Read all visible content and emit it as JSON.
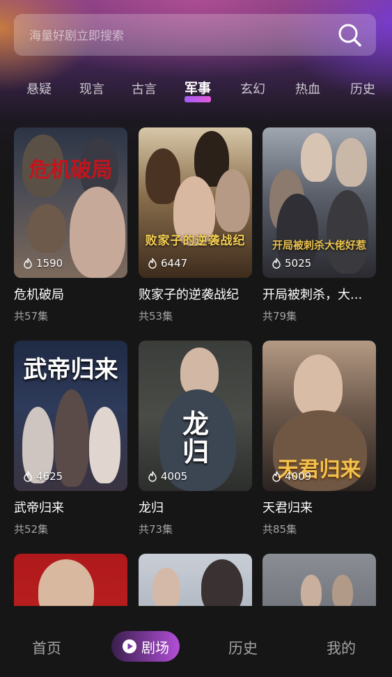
{
  "search": {
    "placeholder": "海量好剧立即搜索"
  },
  "tabs": [
    "悬疑",
    "现言",
    "古言",
    "军事",
    "玄幻",
    "热血",
    "历史"
  ],
  "active_tab": "军事",
  "cards": [
    {
      "title": "危机破局",
      "episodes": "共57集",
      "views": "1590",
      "poster_text": "危机破局"
    },
    {
      "title": "败家子的逆袭战纪",
      "episodes": "共53集",
      "views": "6447",
      "poster_text": "败家子的逆袭战纪"
    },
    {
      "title": "开局被刺杀，大...",
      "episodes": "共79集",
      "views": "5025",
      "poster_text": "开局被刺杀大佬好惹"
    },
    {
      "title": "武帝归来",
      "episodes": "共52集",
      "views": "4625",
      "poster_text": "武帝归来"
    },
    {
      "title": "龙归",
      "episodes": "共73集",
      "views": "4005",
      "poster_text": "龙归"
    },
    {
      "title": "天君归来",
      "episodes": "共85集",
      "views": "4009",
      "poster_text": "天君归来"
    }
  ],
  "nav": {
    "home": "首页",
    "theater": "剧场",
    "history": "历史",
    "mine": "我的"
  },
  "colors": {
    "accent": "#b24fd8",
    "tab_underline": "#a25cf5"
  }
}
